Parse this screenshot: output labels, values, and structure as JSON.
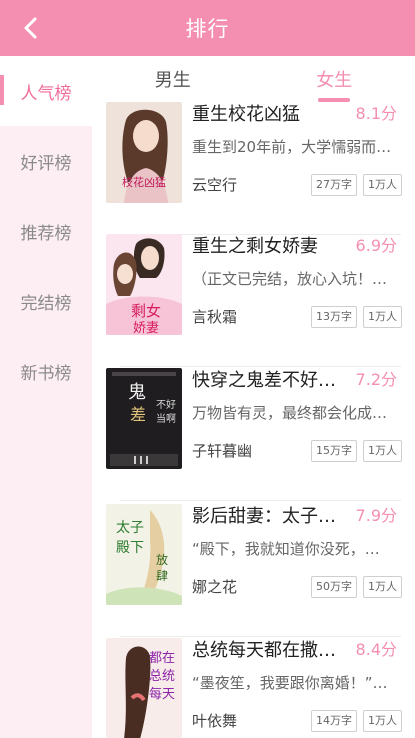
{
  "header": {
    "title": "排行",
    "back_icon": "chevron-left-icon"
  },
  "tabs": [
    {
      "label": "男生",
      "active": false
    },
    {
      "label": "女生",
      "active": true
    }
  ],
  "sidebar": {
    "items": [
      {
        "label": "人气榜",
        "active": true
      },
      {
        "label": "好评榜",
        "active": false
      },
      {
        "label": "推荐榜",
        "active": false
      },
      {
        "label": "完结榜",
        "active": false
      },
      {
        "label": "新书榜",
        "active": false
      }
    ]
  },
  "colors": {
    "accent": "#f48fb1",
    "sidebar_bg": "#fdeef3"
  },
  "books": [
    {
      "title": "重生校花凶猛",
      "score": "8.1分",
      "desc": "重生到20年前，大学懦弱而…",
      "author": "云空行",
      "words": "27万字",
      "readers": "1万人"
    },
    {
      "title": "重生之剩女娇妻",
      "score": "6.9分",
      "desc": "（正文已完结，放心入坑！…",
      "author": "言秋霜",
      "words": "13万字",
      "readers": "1万人"
    },
    {
      "title": "快穿之鬼差不好…",
      "score": "7.2分",
      "desc": "万物皆有灵，最终都会化成…",
      "author": "子轩暮幽",
      "words": "15万字",
      "readers": "1万人"
    },
    {
      "title": "影后甜妻：太子…",
      "score": "7.9分",
      "desc": "“殿下，我就知道你没死，…",
      "author": "娜之花",
      "words": "50万字",
      "readers": "1万人"
    },
    {
      "title": "总统每天都在撒…",
      "score": "8.4分",
      "desc": "“墨夜笙，我要跟你离婚！”…",
      "author": "叶依舞",
      "words": "14万字",
      "readers": "1万人"
    }
  ]
}
